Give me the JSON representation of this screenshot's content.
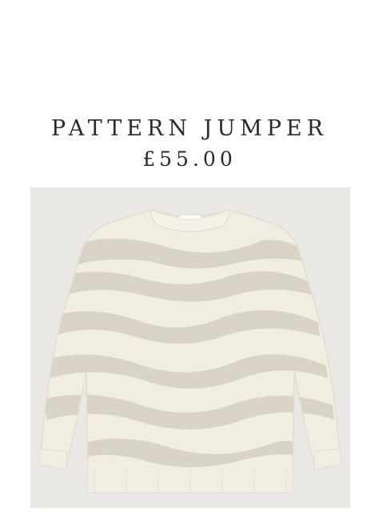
{
  "product": {
    "name": "PATTERN JUMPER",
    "price": "£55.00"
  },
  "image": {
    "label_icon": "sweater-illustration",
    "background": "#e9e8e4",
    "knit_cream": "#f1ede0",
    "knit_stripe": "#d9d4c6"
  }
}
